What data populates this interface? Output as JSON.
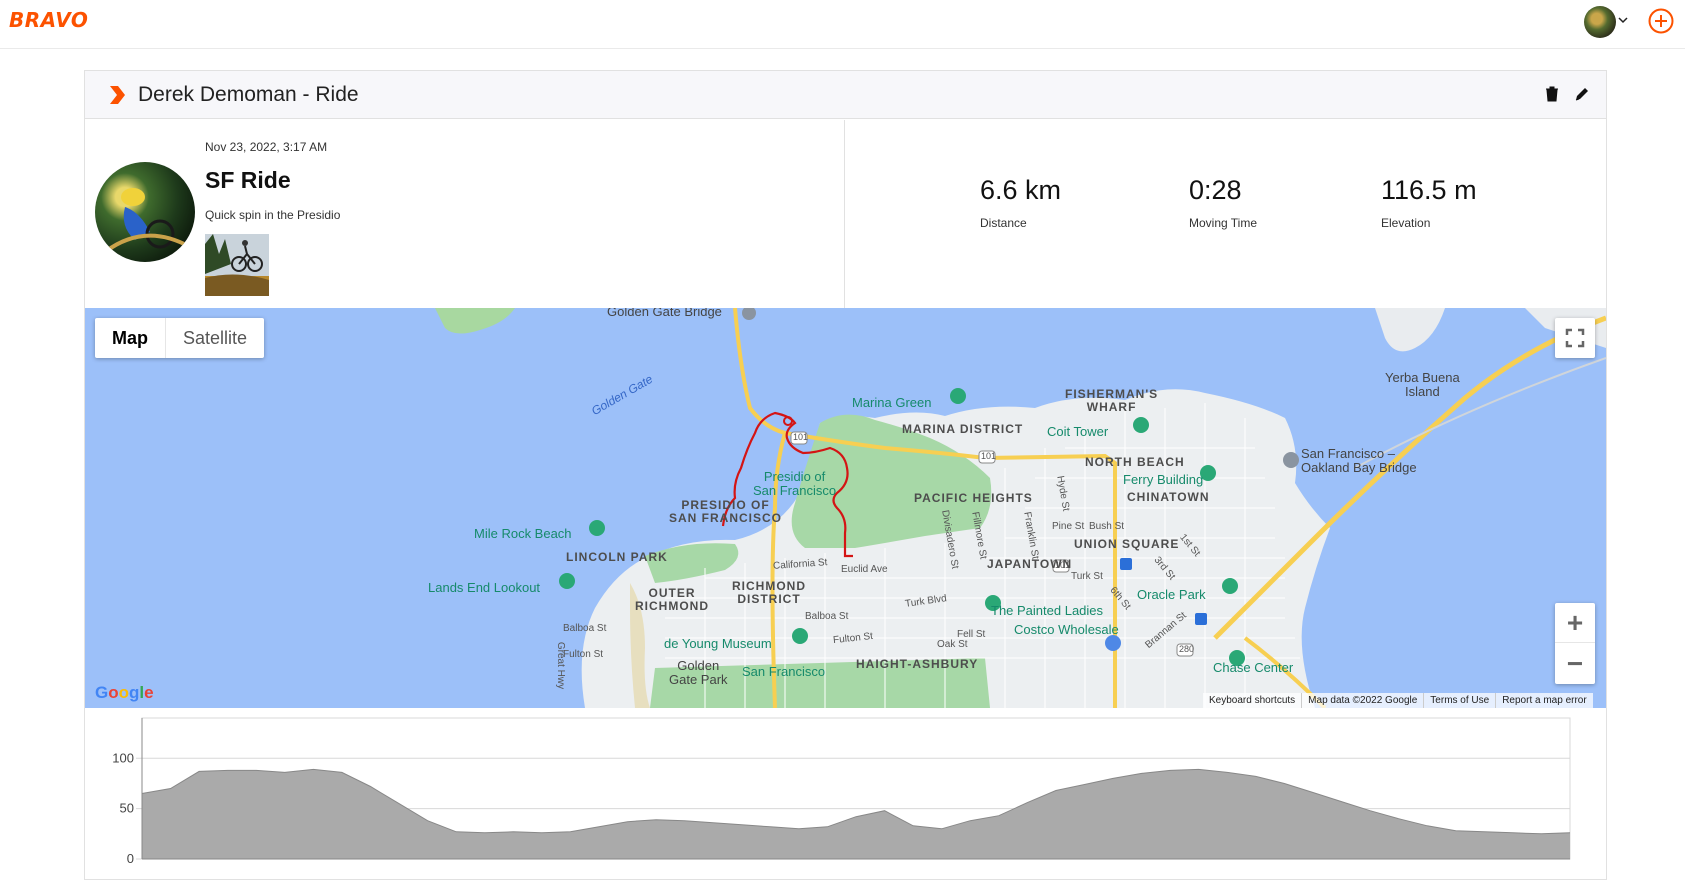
{
  "app": {
    "logo": "BRAVO",
    "brand_color": "#fc5200"
  },
  "nav": {
    "avatar_icon": "user-avatar-icon",
    "menu_icon": "chevron-down-icon",
    "add_icon": "plus-circle-icon"
  },
  "card": {
    "title": "Derek Demoman - Ride",
    "delete_icon": "trash-icon",
    "edit_icon": "pencil-icon"
  },
  "activity": {
    "date": "Nov 23, 2022, 3:17 AM",
    "name": "SF Ride",
    "description": "Quick spin in the Presidio"
  },
  "stats": [
    {
      "value": "6.6 km",
      "label": "Distance"
    },
    {
      "value": "0:28",
      "label": "Moving Time"
    },
    {
      "value": "116.5 m",
      "label": "Elevation"
    }
  ],
  "map": {
    "type_buttons": {
      "map": "Map",
      "satellite": "Satellite"
    },
    "selected_type": "Map",
    "zoom_in": "+",
    "zoom_out": "−",
    "google": "Google",
    "footer": {
      "shortcuts": "Keyboard shortcuts",
      "data": "Map data ©2022 Google",
      "terms": "Terms of Use",
      "report": "Report a map error"
    },
    "labels": {
      "golden_gate_bridge": "Golden Gate Bridge",
      "golden_gate": "Golden Gate",
      "marina_green": "Marina Green",
      "fishermans_wharf_1": "FISHERMAN'S",
      "fishermans_wharf_2": "WHARF",
      "marina_district": "MARINA DISTRICT",
      "coit_tower": "Coit Tower",
      "yerba_buena_1": "Yerba Buena",
      "yerba_buena_2": "Island",
      "sf_bay_bridge_1": "San Francisco –",
      "sf_bay_bridge_2": "Oakland Bay Bridge",
      "north_beach": "NORTH BEACH",
      "ferry_building": "Ferry Building",
      "presidio_sf_1": "Presidio of",
      "presidio_sf_2": "San Francisco",
      "presidio_of_1": "PRESIDIO OF",
      "presidio_of_2": "SAN FRANCISCO",
      "pacific_heights": "PACIFIC HEIGHTS",
      "chinatown": "CHINATOWN",
      "mile_rock_beach": "Mile Rock Beach",
      "lincoln_park": "LINCOLN PARK",
      "union_square": "UNION SQUARE",
      "japantown": "JAPANTOWN",
      "lands_end": "Lands End Lookout",
      "outer_richmond_1": "OUTER",
      "outer_richmond_2": "RICHMOND",
      "richmond_district_1": "RICHMOND",
      "richmond_district_2": "DISTRICT",
      "oracle_park": "Oracle Park",
      "painted_ladies": "The Painted Ladies",
      "costco": "Costco Wholesale",
      "de_young": "de Young Museum",
      "golden_gate_park_1": "Golden",
      "golden_gate_park_2": "Gate Park",
      "san_francisco": "San Francisco",
      "haight_ashbury": "HAIGHT-ASHBURY",
      "chase_center": "Chase Center",
      "california_st": "California St",
      "euclid_ave": "Euclid Ave",
      "turk_blvd": "Turk Blvd",
      "balboa_st": "Balboa St",
      "balboa_st_2": "Balboa St",
      "fulton_st": "Fulton St",
      "fulton_st_2": "Fulton St",
      "oak_st": "Oak St",
      "fell_st": "Fell St",
      "turk_st": "Turk St",
      "pine_st": "Pine St",
      "bush_st": "Bush St",
      "divisadero": "Divisadero St",
      "fillmore": "Fillmore St",
      "franklin": "Franklin St",
      "hyde": "Hyde St",
      "great_hwy": "Great Hwy",
      "sixth_st": "6th St",
      "third_st": "3rd St",
      "first_st": "1st St",
      "brannan": "Brannan St",
      "us101_a": "101",
      "us101_b": "101",
      "us101_c": "101",
      "i280": "280"
    }
  },
  "chart_data": {
    "type": "area",
    "x": [
      0,
      0.02,
      0.04,
      0.06,
      0.08,
      0.1,
      0.12,
      0.14,
      0.16,
      0.18,
      0.2,
      0.22,
      0.24,
      0.26,
      0.28,
      0.3,
      0.32,
      0.34,
      0.36,
      0.38,
      0.4,
      0.42,
      0.44,
      0.46,
      0.48,
      0.5,
      0.52,
      0.54,
      0.56,
      0.58,
      0.6,
      0.62,
      0.64,
      0.66,
      0.68,
      0.7,
      0.72,
      0.74,
      0.76,
      0.78,
      0.8,
      0.82,
      0.84,
      0.86,
      0.88,
      0.9,
      0.92,
      0.94,
      0.96,
      0.98,
      1.0
    ],
    "values": [
      65,
      70,
      87,
      88,
      88,
      86,
      89,
      86,
      72,
      55,
      38,
      27,
      26,
      27,
      26,
      27,
      32,
      37,
      39,
      38,
      36,
      34,
      32,
      30,
      32,
      42,
      48,
      33,
      30,
      38,
      43,
      56,
      68,
      74,
      80,
      85,
      88,
      89,
      86,
      82,
      75,
      66,
      57,
      48,
      40,
      33,
      28,
      27,
      26,
      25,
      26
    ],
    "yticks": [
      "0",
      "50",
      "100"
    ],
    "ylim": [
      0,
      140
    ],
    "grid": true,
    "fill_color": "#aaaaaa",
    "line_color": "#888888"
  }
}
